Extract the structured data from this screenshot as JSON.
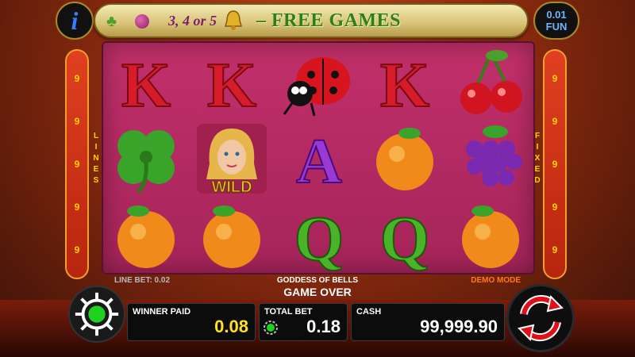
{
  "header": {
    "info_label": "i",
    "scatter_text": "3, 4 or 5",
    "free_games_text": "– FREE GAMES",
    "denomination": "0.01",
    "currency": "FUN"
  },
  "reels": [
    [
      "k-symbol",
      "clover-symbol",
      "orange-symbol"
    ],
    [
      "k-symbol",
      "wild-symbol",
      "orange-symbol"
    ],
    [
      "ladybug-symbol",
      "a-symbol",
      "q-symbol"
    ],
    [
      "k-symbol",
      "orange-symbol",
      "q-symbol"
    ],
    [
      "cherry-symbol",
      "grape-symbol",
      "orange-symbol"
    ]
  ],
  "wild_label": "WILD",
  "left_bar": {
    "values": [
      "9",
      "9",
      "9",
      "9",
      "9"
    ],
    "label": [
      "L",
      "I",
      "N",
      "E",
      "S"
    ]
  },
  "right_bar": {
    "values": [
      "9",
      "9",
      "9",
      "9",
      "9"
    ],
    "label": [
      "F",
      "I",
      "X",
      "E",
      "D"
    ]
  },
  "info_strip": {
    "line_bet": "LINE BET: 0.02",
    "game_name": "GODDESS OF BELLS",
    "demo_mode": "DEMO MODE",
    "status": "GAME OVER"
  },
  "bottom": {
    "winner_paid_label": "WINNER PAID",
    "winner_paid_value": "0.08",
    "total_bet_label": "TOTAL BET",
    "total_bet_value": "0.18",
    "cash_label": "CASH",
    "cash_value": "99,999.90"
  },
  "colors": {
    "reel_bg": "#b32a62",
    "line_bar": "#d2361a",
    "accent_yellow": "#ffe21a",
    "clover_green": "#3aa32a"
  }
}
